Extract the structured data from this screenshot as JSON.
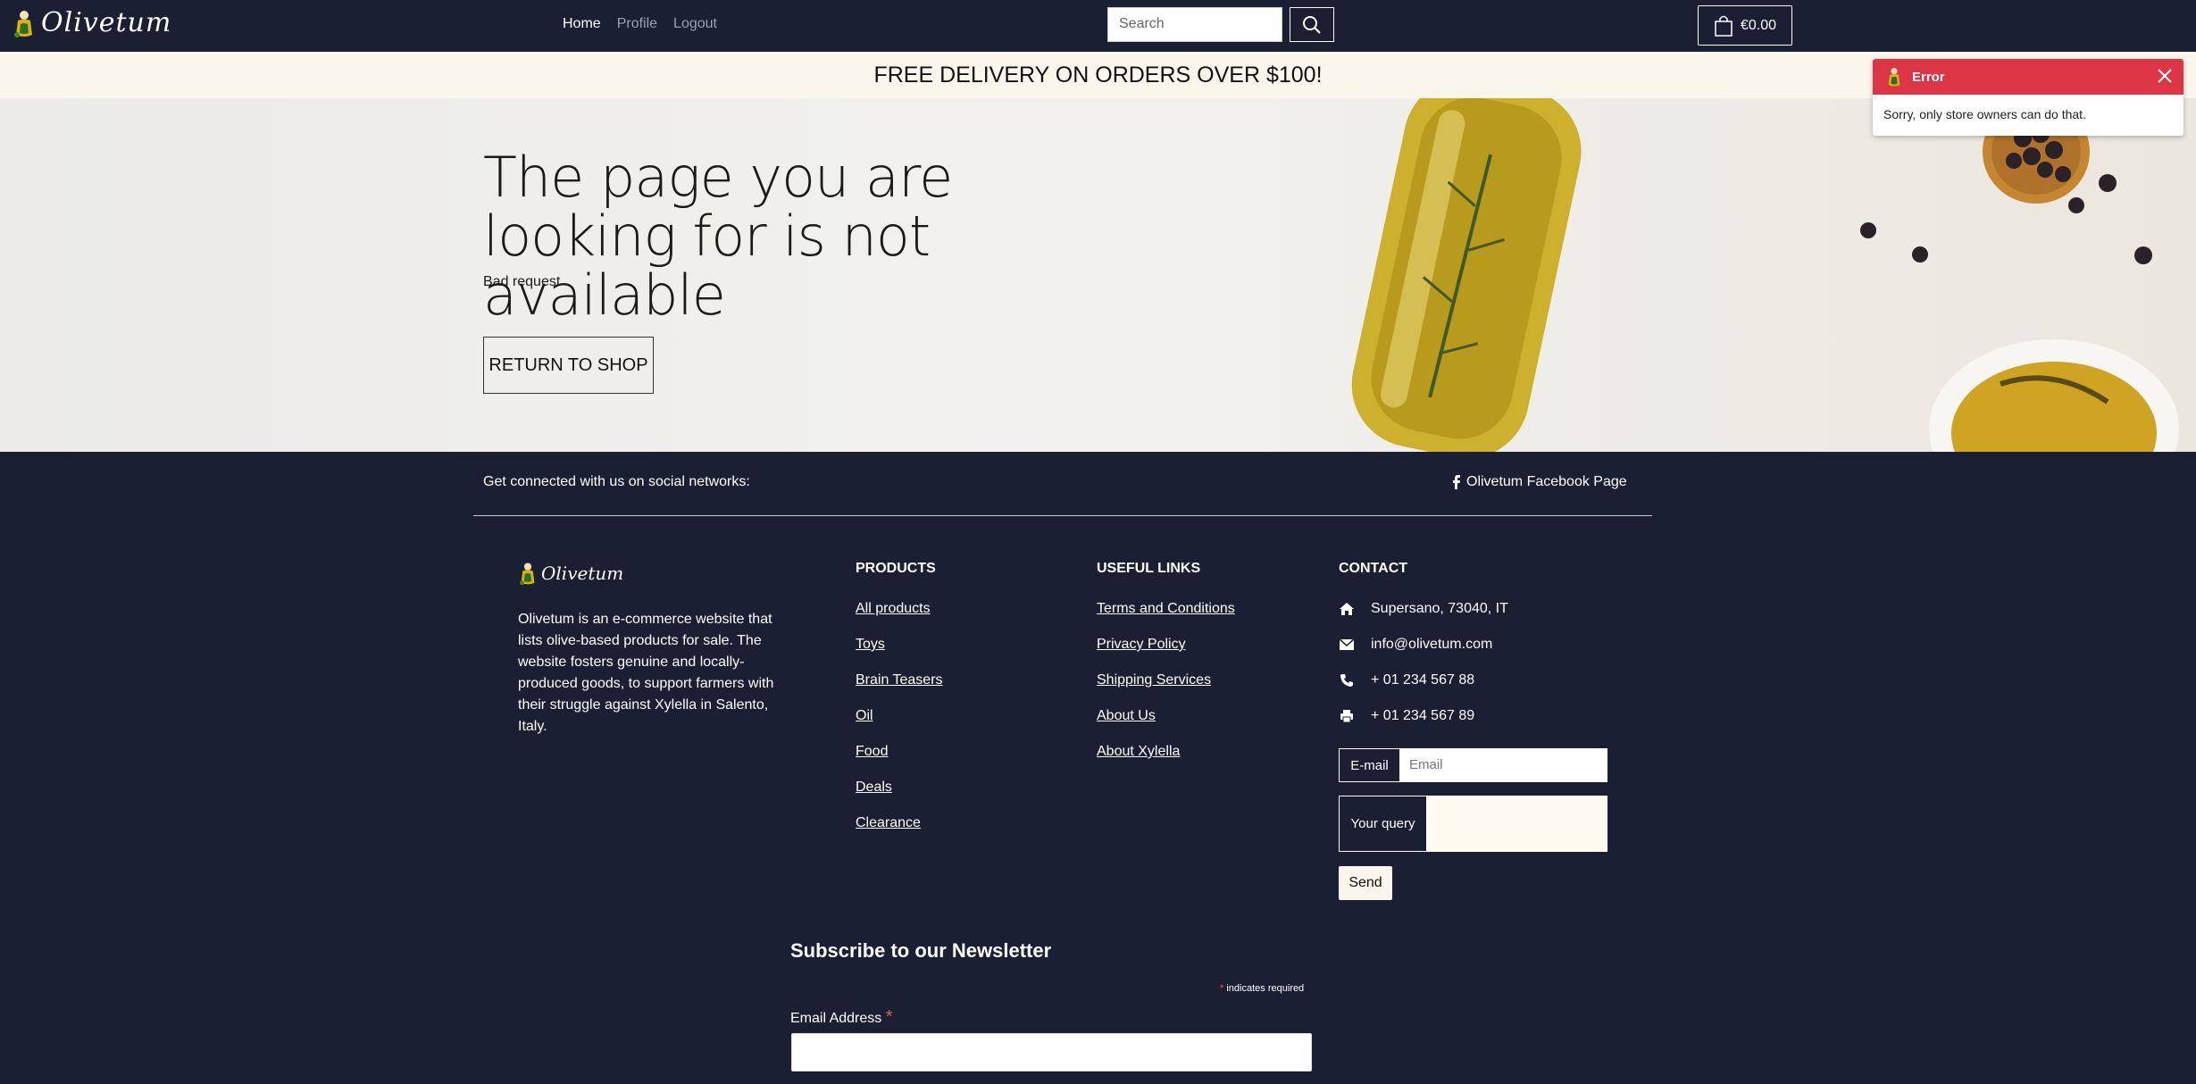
{
  "navbar": {
    "brand": "Olivetum",
    "links": [
      {
        "label": "Home",
        "active": true
      },
      {
        "label": "Profile",
        "active": false
      },
      {
        "label": "Logout",
        "active": false
      }
    ],
    "search_placeholder": "Search",
    "cart_total": "€0.00"
  },
  "promo": "FREE DELIVERY ON ORDERS OVER $100!",
  "hero": {
    "title": "The page you are looking for is not available",
    "subtitle": "Bad request",
    "button": "RETURN TO SHOP"
  },
  "toast": {
    "title": "Error",
    "message": "Sorry, only store owners can do that."
  },
  "footer": {
    "social_text": "Get connected with us on social networks:",
    "facebook_link": "Olivetum Facebook Page",
    "brand": "Olivetum",
    "about": "Olivetum is an e-commerce website that lists olive-based products for sale. The website fosters genuine and locally-produced goods, to support farmers with their struggle against Xylella in Salento, Italy.",
    "products": {
      "heading": "PRODUCTS",
      "links": [
        "All products",
        "Toys",
        "Brain Teasers",
        "Oil",
        "Food",
        "Deals",
        "Clearance"
      ]
    },
    "useful": {
      "heading": "USEFUL LINKS",
      "links": [
        "Terms and Conditions",
        "Privacy Policy",
        "Shipping Services",
        "About Us",
        "About Xylella"
      ]
    },
    "contact": {
      "heading": "CONTACT",
      "address": "Supersano, 73040, IT",
      "email": "info@olivetum.com",
      "phone": "+ 01 234 567 88",
      "fax": "+ 01 234 567 89",
      "email_label": "E-mail",
      "email_placeholder": "Email",
      "query_label": "Your query",
      "send": "Send"
    },
    "newsletter": {
      "title": "Subscribe to our Newsletter",
      "required_star": "*",
      "required_note": "indicates required",
      "email_label": "Email Address",
      "email_star": "*"
    }
  }
}
